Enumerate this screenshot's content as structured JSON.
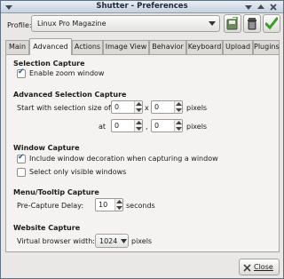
{
  "window": {
    "title": "Shutter - Preferences"
  },
  "profile": {
    "label": "Profile:",
    "value": "Linux Pro Magazine"
  },
  "tabs": [
    "Main",
    "Advanced",
    "Actions",
    "Image View",
    "Behavior",
    "Keyboard",
    "Upload",
    "Plugins"
  ],
  "active_tab": "Advanced",
  "selection_capture": {
    "heading": "Selection Capture",
    "zoom_label": "Enable zoom window",
    "zoom_checked": true
  },
  "advanced_selection": {
    "heading": "Advanced Selection Capture",
    "size_label": "Start with selection size of",
    "width": "0",
    "x_sep": "x",
    "height": "0",
    "pixels1": "pixels",
    "at_label": "at",
    "pos_x": "0",
    "comma": ",",
    "pos_y": "0",
    "pixels2": "pixels"
  },
  "window_capture": {
    "heading": "Window Capture",
    "decoration_label": "Include window decoration when capturing a window",
    "decoration_checked": true,
    "visible_label": "Select only visible windows",
    "visible_checked": false
  },
  "menu_capture": {
    "heading": "Menu/Tooltip Capture",
    "delay_label": "Pre-Capture Delay:",
    "delay_value": "10",
    "delay_unit": "seconds"
  },
  "website_capture": {
    "heading": "Website Capture",
    "width_label": "Virtual browser width:",
    "width_value": "1024",
    "width_unit": "pixels"
  },
  "footer": {
    "close_label": "Close"
  },
  "icons": {
    "save": "save-profile-icon",
    "delete": "delete-profile-icon",
    "apply": "apply-profile-icon",
    "close": "close-icon"
  },
  "colors": {
    "titlebar": "#c6d1de",
    "accent": "#2f5f99",
    "apply_green": "#3c9a2a"
  }
}
